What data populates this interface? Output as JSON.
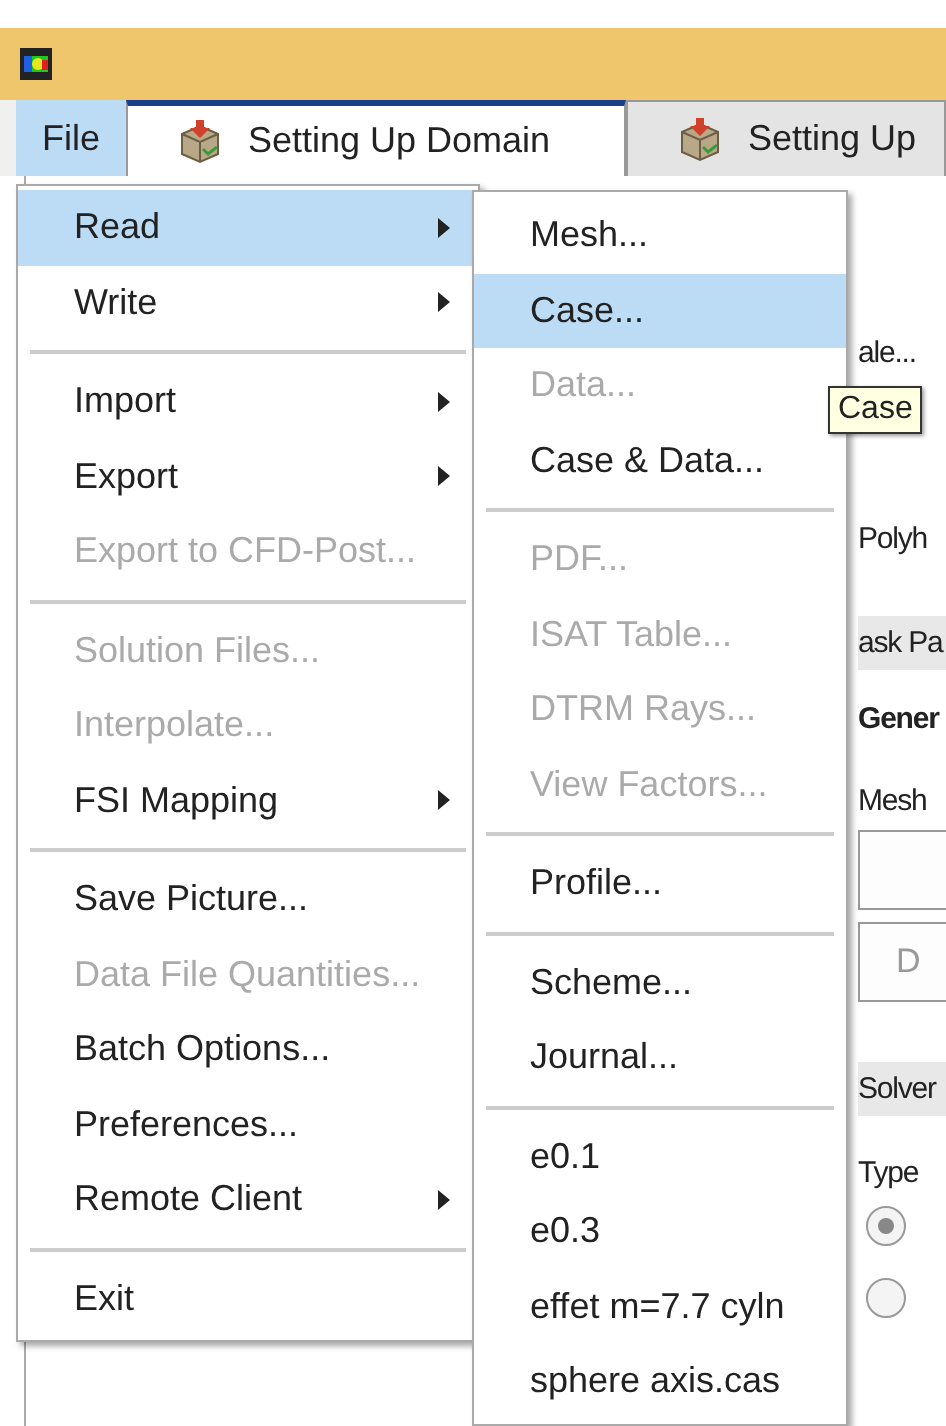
{
  "menubar": {
    "file": {
      "label": "File",
      "selected": true
    }
  },
  "tabs": [
    {
      "label": "Setting Up Domain",
      "selected": true
    },
    {
      "label": "Setting Up",
      "selected": false
    }
  ],
  "file_menu": {
    "items": [
      {
        "kind": "item",
        "label": "Read",
        "submenu": true,
        "selected": true,
        "disabled": false
      },
      {
        "kind": "item",
        "label": "Write",
        "submenu": true,
        "selected": false,
        "disabled": false
      },
      {
        "kind": "separator"
      },
      {
        "kind": "item",
        "label": "Import",
        "submenu": true,
        "selected": false,
        "disabled": false
      },
      {
        "kind": "item",
        "label": "Export",
        "submenu": true,
        "selected": false,
        "disabled": false
      },
      {
        "kind": "item",
        "label": "Export to CFD-Post...",
        "submenu": false,
        "selected": false,
        "disabled": true
      },
      {
        "kind": "separator"
      },
      {
        "kind": "item",
        "label": "Solution Files...",
        "submenu": false,
        "selected": false,
        "disabled": true
      },
      {
        "kind": "item",
        "label": "Interpolate...",
        "submenu": false,
        "selected": false,
        "disabled": true
      },
      {
        "kind": "item",
        "label": "FSI Mapping",
        "submenu": true,
        "selected": false,
        "disabled": false
      },
      {
        "kind": "separator"
      },
      {
        "kind": "item",
        "label": "Save Picture...",
        "submenu": false,
        "selected": false,
        "disabled": false
      },
      {
        "kind": "item",
        "label": "Data File Quantities...",
        "submenu": false,
        "selected": false,
        "disabled": true
      },
      {
        "kind": "item",
        "label": "Batch Options...",
        "submenu": false,
        "selected": false,
        "disabled": false
      },
      {
        "kind": "item",
        "label": "Preferences...",
        "submenu": false,
        "selected": false,
        "disabled": false
      },
      {
        "kind": "item",
        "label": "Remote Client",
        "submenu": true,
        "selected": false,
        "disabled": false
      },
      {
        "kind": "separator"
      },
      {
        "kind": "item",
        "label": "Exit",
        "submenu": false,
        "selected": false,
        "disabled": false
      }
    ]
  },
  "read_submenu": {
    "items": [
      {
        "kind": "item",
        "label": "Mesh...",
        "selected": false,
        "disabled": false
      },
      {
        "kind": "item",
        "label": "Case...",
        "selected": true,
        "disabled": false
      },
      {
        "kind": "item",
        "label": "Data...",
        "selected": false,
        "disabled": true
      },
      {
        "kind": "item",
        "label": "Case & Data...",
        "selected": false,
        "disabled": false
      },
      {
        "kind": "separator"
      },
      {
        "kind": "item",
        "label": "PDF...",
        "selected": false,
        "disabled": true
      },
      {
        "kind": "item",
        "label": "ISAT Table...",
        "selected": false,
        "disabled": true
      },
      {
        "kind": "item",
        "label": "DTRM Rays...",
        "selected": false,
        "disabled": true
      },
      {
        "kind": "item",
        "label": "View Factors...",
        "selected": false,
        "disabled": true
      },
      {
        "kind": "separator"
      },
      {
        "kind": "item",
        "label": "Profile...",
        "selected": false,
        "disabled": false
      },
      {
        "kind": "separator"
      },
      {
        "kind": "item",
        "label": "Scheme...",
        "selected": false,
        "disabled": false
      },
      {
        "kind": "item",
        "label": "Journal...",
        "selected": false,
        "disabled": false
      },
      {
        "kind": "separator"
      },
      {
        "kind": "item",
        "label": "e0.1",
        "selected": false,
        "disabled": false
      },
      {
        "kind": "item",
        "label": "e0.3",
        "selected": false,
        "disabled": false
      },
      {
        "kind": "item",
        "label": "effet m=7.7 cyln",
        "selected": false,
        "disabled": false
      },
      {
        "kind": "item",
        "label": "sphere axis.cas",
        "selected": false,
        "disabled": false
      }
    ]
  },
  "tooltip": {
    "text": "Case"
  },
  "task_panel": {
    "items": [
      {
        "kind": "text",
        "label": "ale..."
      },
      {
        "kind": "text",
        "label": "Polyh"
      },
      {
        "kind": "header",
        "label": "ask Pa"
      },
      {
        "kind": "heading",
        "label": "Gener"
      },
      {
        "kind": "text",
        "label": "Mesh"
      },
      {
        "kind": "button"
      },
      {
        "kind": "button",
        "label": "D"
      },
      {
        "kind": "header",
        "label": "Solver"
      },
      {
        "kind": "text",
        "label": "Type"
      },
      {
        "kind": "radio",
        "selected": true
      },
      {
        "kind": "radio",
        "selected": false
      }
    ]
  }
}
